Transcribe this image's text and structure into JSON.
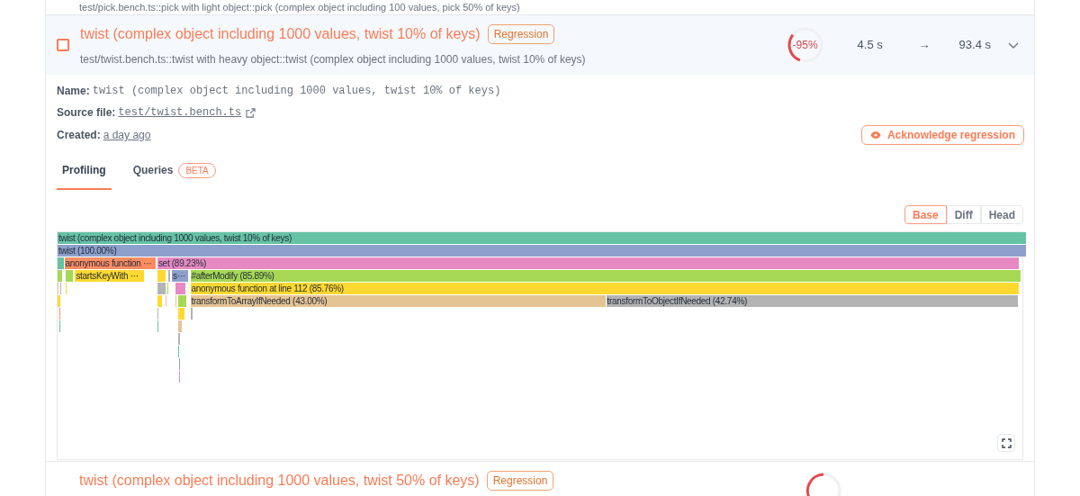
{
  "previous_item": {
    "path": "test/pick.bench.ts::pick with light object::pick (complex object including 100 values, pick 50% of keys)"
  },
  "benchmark": {
    "checked": false,
    "title": "twist (complex object including 1000 values, twist 10% of keys)",
    "badge": "Regression",
    "path": "test/twist.bench.ts::twist with heavy object::twist (complex object including 1000 values, twist 10% of keys)",
    "change": "-95%",
    "gauge": {
      "level": 0.3
    },
    "base_time": "4.5 s",
    "arrow": "→",
    "head_time": "93.4 s",
    "expanded": true,
    "details": {
      "name_label": "Name:",
      "name": "twist (complex object including 1000 values, twist 10% of keys)",
      "source_label": "Source file:",
      "source": "test/twist.bench.ts",
      "created_label": "Created:",
      "created": "a day ago"
    },
    "acknowledge_button": "Acknowledge regression",
    "tabs": [
      {
        "label": "Profiling",
        "selected": true
      },
      {
        "label": "Queries",
        "badge": "BETA",
        "selected": false
      }
    ],
    "view_toggle": [
      {
        "label": "Base",
        "selected": true
      },
      {
        "label": "Diff",
        "selected": false
      },
      {
        "label": "Head",
        "selected": false
      }
    ],
    "flame_graph": {
      "rows": [
        {
          "frames": [
            {
              "label": "twist (complex object including 1000 values, twist 10% of keys)",
              "color": "#66c2a5"
            }
          ]
        },
        {
          "frames": [
            {
              "label": "twist (100.00%)",
              "color": "#8da0cb"
            }
          ]
        },
        {
          "frames": [
            {
              "color": "#66c2a5"
            },
            {
              "label": "anonymous function ···",
              "color": "#fc8d62"
            },
            {
              "label": "set (89.23%)",
              "color": "#e78ac3"
            }
          ]
        },
        {
          "frames": [
            {
              "color": "#a6d854"
            },
            {
              "color": "#a6d854"
            },
            {
              "label": "startsKeyWith ···",
              "color": "#ffd92f"
            },
            {
              "color": "#ffd92f"
            },
            {
              "color": "#b3b3b3"
            },
            {
              "label": "s···",
              "color": "#8da0cb"
            },
            {
              "label": "#afterModify (85.89%)",
              "color": "#a6d854"
            }
          ]
        },
        {
          "frames": [
            {
              "color": "#e5c494"
            },
            {
              "color": "#b3b3b3"
            },
            {
              "color": "#ffd92f"
            },
            {
              "color": "#b3b3b3"
            },
            {
              "color": "#a6d854"
            },
            {
              "color": "#e78ac3"
            },
            {
              "label": "anonymous function at line 112 (85.76%)",
              "color": "#ffd92f"
            }
          ]
        },
        {
          "frames": [
            {
              "color": "#ffd92f"
            },
            {
              "color": "#ffd92f"
            },
            {
              "color": "#e5c494"
            },
            {
              "color": "#e5c494"
            },
            {
              "color": "#a6d854"
            },
            {
              "label": "transformToArrayIfNeeded (43.00%)",
              "color": "#e5c494"
            },
            {
              "label": "transformToObjectIfNeeded (42.74%)",
              "color": "#b3b3b3"
            }
          ]
        },
        {
          "frames": [
            {
              "color": "#fc8d62"
            },
            {
              "color": "#b3b3b3"
            },
            {
              "color": "#ffd92f"
            },
            {
              "color": "#b3b3b3"
            }
          ]
        },
        {
          "frames": [
            {
              "color": "#66c2a5"
            },
            {
              "color": "#66c2a5"
            },
            {
              "color": "#e5c494"
            }
          ]
        },
        {
          "frames": [
            {
              "color": "#b3b3b3"
            }
          ]
        },
        {
          "frames": [
            {
              "color": "#66c2a5"
            }
          ]
        },
        {
          "frames": [
            {
              "color": "#8da0cb"
            }
          ]
        },
        {
          "frames": [
            {
              "color": "#e78ac3"
            }
          ]
        }
      ]
    }
  },
  "next_item": {
    "title": "twist (complex object including 1000 values, twist 50% of keys)",
    "badge": "Regression"
  }
}
